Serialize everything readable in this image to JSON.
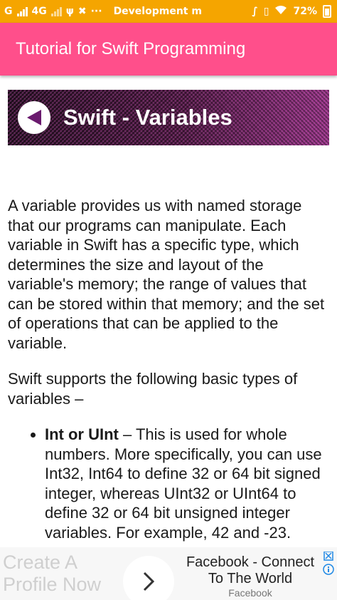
{
  "status_bar": {
    "carrier": "G",
    "network": "4G",
    "notification_text": "Development m",
    "battery": "72%"
  },
  "app_bar": {
    "title": "Tutorial for Swift Programming"
  },
  "banner": {
    "title": "Swift - Variables"
  },
  "content": {
    "paragraph_1": "A variable provides us with named storage that our programs can manipulate. Each variable in Swift has a specific type, which determines the size and layout of the variable's memory; the range of values that can be stored within that memory; and the set of operations that can be applied to the variable.",
    "paragraph_2": "Swift supports the following basic types of variables –",
    "list": [
      {
        "term": "Int or UInt",
        "description": " – This is used for whole numbers. More specifically, you can use Int32, Int64 to define 32 or 64 bit signed integer, whereas UInt32 or UInt64 to define 32 or 64 bit unsigned integer variables. For example, 42 and -23."
      }
    ]
  },
  "ad": {
    "left_text": "Create A Profile Now",
    "title": "Facebook - Connect To The World",
    "advertiser": "Facebook"
  },
  "colors": {
    "status_bar": "#f5a500",
    "app_bar": "#ff4f8b",
    "banner_accent": "#6a1a6e"
  },
  "icons": {
    "banner": "back-triangle-icon",
    "ad_button": "chevron-right-icon",
    "ad_info": "info-icon"
  }
}
